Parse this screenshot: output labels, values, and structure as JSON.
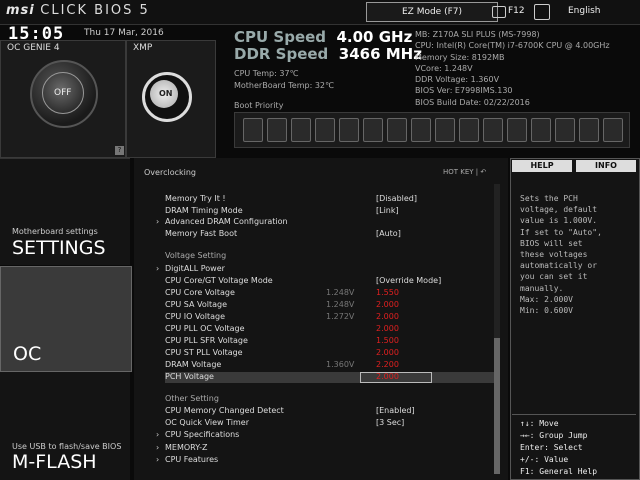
{
  "brand": {
    "logo": "msi",
    "product": "CLICK BIOS 5"
  },
  "topbar": {
    "ez_mode": "EZ Mode (F7)",
    "screenshot_key": "F12",
    "language": "English"
  },
  "clock": {
    "time": "15:05",
    "date": "Thu 17 Mar, 2016"
  },
  "genie": {
    "title": "OC GENIE 4",
    "state": "OFF"
  },
  "xmp": {
    "title": "XMP",
    "state": "ON",
    "help": "?"
  },
  "speeds": {
    "cpu_label": "CPU Speed",
    "cpu_value": "4.00 GHz",
    "ddr_label": "DDR Speed",
    "ddr_value": "3466 MHz",
    "cpu_temp": "CPU Temp: 37℃",
    "mb_temp": "MotherBoard Temp: 32℃"
  },
  "sysinfo": [
    "MB: Z170A SLI PLUS (MS-7998)",
    "CPU: Intel(R) Core(TM) i7-6700K CPU @ 4.00GHz",
    "Memory Size: 8192MB",
    "VCore: 1.248V",
    "DDR Voltage: 1.360V",
    "BIOS Ver: E7998IMS.130",
    "BIOS Build Date: 02/22/2016"
  ],
  "boot": {
    "label": "Boot Priority",
    "device_count": 16
  },
  "nav": {
    "settings_sub": "Motherboard settings",
    "settings": "SETTINGS",
    "oc": "OC",
    "mflash_sub": "Use USB to flash/save BIOS",
    "mflash": "M-FLASH"
  },
  "main": {
    "section": "Overclocking",
    "hotkey": "HOT KEY  |  ↶",
    "rows": [
      {
        "label": "Memory Try It !",
        "val": "[Disabled]"
      },
      {
        "label": "DRAM Timing Mode",
        "val": "[Link]"
      },
      {
        "label": "Advanced DRAM Configuration",
        "val": "",
        "arrow": true
      },
      {
        "label": "Memory Fast Boot",
        "val": "[Auto]"
      },
      {
        "label": "Voltage  Setting",
        "val": "",
        "group": true
      },
      {
        "label": "DigitALL Power",
        "val": "",
        "arrow": true
      },
      {
        "label": "CPU Core/GT Voltage Mode",
        "val": "[Override Mode]"
      },
      {
        "label": "CPU Core Voltage",
        "cur": "1.248V",
        "val": "1.550",
        "red": true
      },
      {
        "label": "CPU SA Voltage",
        "cur": "1.248V",
        "val": "2.000",
        "red": true
      },
      {
        "label": "CPU IO Voltage",
        "cur": "1.272V",
        "val": "2.000",
        "red": true
      },
      {
        "label": "CPU PLL OC Voltage",
        "val": "2.000",
        "red": true
      },
      {
        "label": "CPU PLL SFR Voltage",
        "val": "1.500",
        "red": true
      },
      {
        "label": "CPU ST PLL Voltage",
        "val": "2.000",
        "red": true
      },
      {
        "label": "DRAM Voltage",
        "cur": "1.360V",
        "val": "2.200",
        "red": true
      },
      {
        "label": "PCH Voltage",
        "val": "2.000",
        "red": true,
        "selected": true
      },
      {
        "label": "Other  Setting",
        "val": "",
        "group": true
      },
      {
        "label": "CPU Memory Changed Detect",
        "val": "[Enabled]"
      },
      {
        "label": "OC Quick View Timer",
        "val": "[3 Sec]"
      },
      {
        "label": "CPU Specifications",
        "val": "",
        "arrow": true
      },
      {
        "label": "MEMORY-Z",
        "val": "",
        "arrow": true
      },
      {
        "label": "CPU Features",
        "val": "",
        "arrow": true
      }
    ]
  },
  "help": {
    "tab_help": "HELP",
    "tab_info": "INFO",
    "text": "Sets the PCH\nvoltage, default\nvalue is 1.000V.\nIf set to \"Auto\",\nBIOS will set\nthese voltages\nautomatically or\nyou can set it\nmanually.\nMax: 2.000V\nMin: 0.600V",
    "keys": "↑↓: Move\n→←: Group Jump\nEnter: Select\n+/-: Value\nF1: General Help"
  },
  "colors": {
    "warning": "#e02020",
    "background": "#0a0a0a"
  }
}
